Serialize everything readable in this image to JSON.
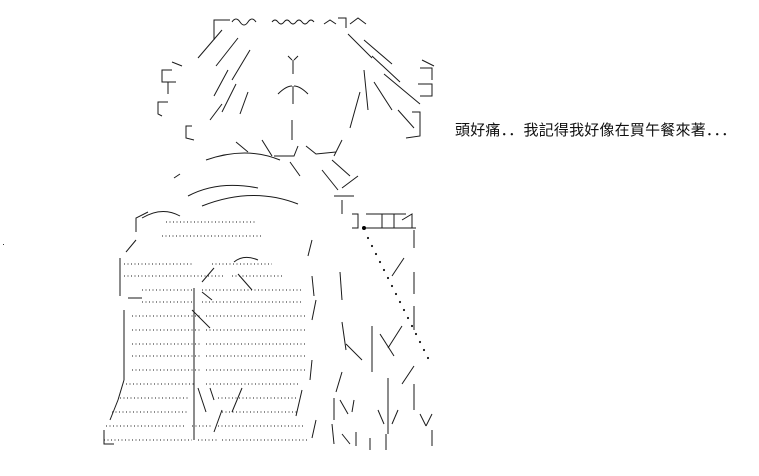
{
  "caption": {
    "text": "頭好痛．．我記得我好像在買午餐來著．．．"
  },
  "art": {
    "icon": "ascii-art-character-icon",
    "ink_color": "#1a1a1a"
  }
}
